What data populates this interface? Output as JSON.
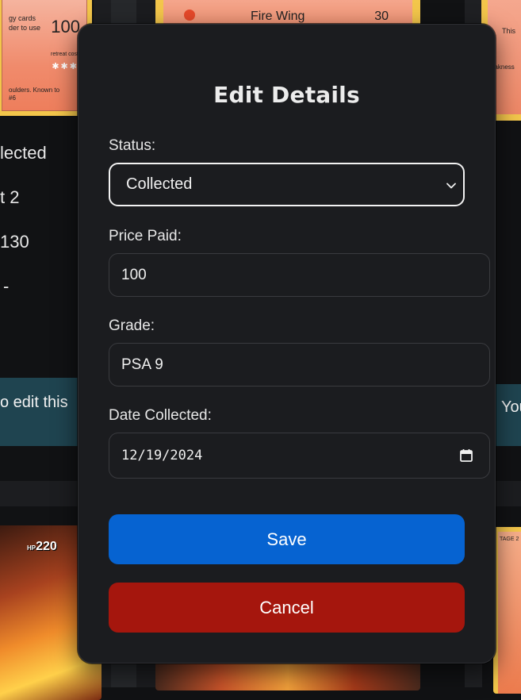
{
  "modal": {
    "title": "Edit Details",
    "status": {
      "label": "Status:",
      "value": "Collected"
    },
    "price": {
      "label": "Price Paid:",
      "value": "100"
    },
    "grade": {
      "label": "Grade:",
      "value": "PSA 9"
    },
    "date": {
      "label": "Date Collected:",
      "value": "12/19/2024"
    },
    "save_label": "Save",
    "cancel_label": "Cancel",
    "colors": {
      "save": "#0663d1",
      "cancel": "#a5160d",
      "background": "#1b1c1f"
    }
  },
  "background": {
    "card_top_left": {
      "text_line1": "gy cards",
      "text_line2": "der to use",
      "number": "100",
      "retreat": "retreat cost",
      "footer_line1": "oulders. Known to",
      "footer_line2": "#6"
    },
    "card_top_mid": {
      "attack_name": "Fire Wing",
      "damage": "30"
    },
    "card_top_right": {
      "text": "This",
      "weakness": "eakness"
    },
    "info_lines": [
      "lected",
      "t 2",
      "130",
      "-"
    ],
    "banner_left": "o edit this",
    "banner_right": "You",
    "card_bottom_left": {
      "hp_prefix": "HP",
      "hp": "220"
    },
    "card_bottom_right": {
      "stage": "TAGE 2"
    }
  }
}
